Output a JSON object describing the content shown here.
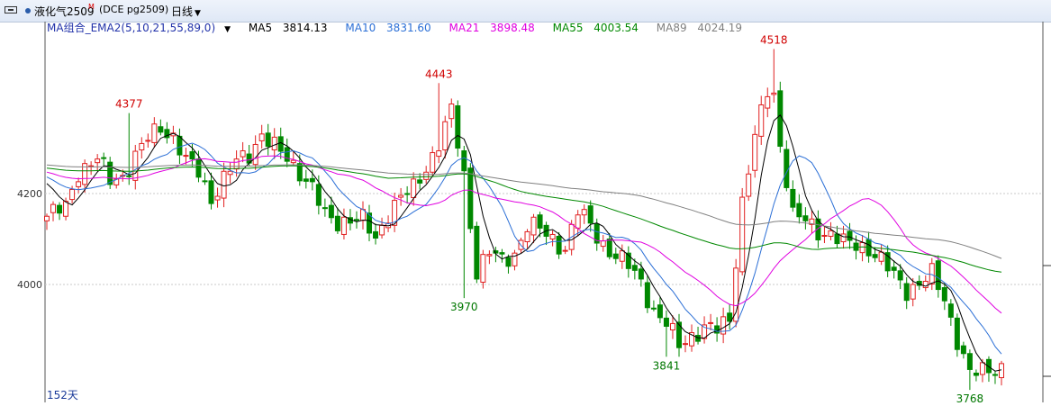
{
  "header": {
    "instrument": "液化气2509",
    "contract_mark": "M",
    "code": "(DCE pg2509)",
    "period": "日线"
  },
  "legend": {
    "group_label": "MA组合_EMA2(5,10,21,55,89,0)",
    "items": [
      {
        "label": "MA5",
        "value": "3814.13",
        "color": "#000000"
      },
      {
        "label": "MA10",
        "value": "3831.60",
        "color": "#2b6fd6"
      },
      {
        "label": "MA21",
        "value": "3898.48",
        "color": "#e000e0"
      },
      {
        "label": "MA55",
        "value": "4003.54",
        "color": "#008800"
      },
      {
        "label": "MA89",
        "value": "4024.19",
        "color": "#808080"
      }
    ]
  },
  "footer": {
    "days_label": "152天"
  },
  "colors": {
    "up": "#e02020",
    "down": "#008800",
    "grid": "#c8c8c8"
  },
  "chart_data": {
    "type": "candlestick",
    "y_ticks": [
      4000,
      4200
    ],
    "ylim": [
      3742,
      4583
    ],
    "grid_dashed": true,
    "candle_count": 152,
    "annotations": [
      {
        "label": "4377",
        "kind": "high",
        "index": 13
      },
      {
        "label": "4443",
        "kind": "high",
        "index": 62
      },
      {
        "label": "3970",
        "kind": "low",
        "index": 66
      },
      {
        "label": "3841",
        "kind": "low",
        "index": 98
      },
      {
        "label": "4518",
        "kind": "high",
        "index": 115
      },
      {
        "label": "3768",
        "kind": "low",
        "index": 146
      }
    ],
    "close_path": [
      [
        0,
        4150
      ],
      [
        3,
        4170
      ],
      [
        5,
        4250
      ],
      [
        8,
        4275
      ],
      [
        10,
        4230
      ],
      [
        12,
        4240
      ],
      [
        14,
        4280
      ],
      [
        16,
        4320
      ],
      [
        18,
        4350
      ],
      [
        20,
        4325
      ],
      [
        22,
        4270
      ],
      [
        24,
        4250
      ],
      [
        26,
        4190
      ],
      [
        28,
        4230
      ],
      [
        30,
        4270
      ],
      [
        32,
        4290
      ],
      [
        34,
        4330
      ],
      [
        36,
        4300
      ],
      [
        38,
        4280
      ],
      [
        40,
        4250
      ],
      [
        42,
        4210
      ],
      [
        44,
        4150
      ],
      [
        46,
        4140
      ],
      [
        48,
        4145
      ],
      [
        50,
        4140
      ],
      [
        52,
        4100
      ],
      [
        54,
        4160
      ],
      [
        56,
        4190
      ],
      [
        58,
        4210
      ],
      [
        60,
        4260
      ],
      [
        62,
        4310
      ],
      [
        64,
        4380
      ],
      [
        66,
        4240
      ],
      [
        68,
        4030
      ],
      [
        70,
        4070
      ],
      [
        72,
        4050
      ],
      [
        74,
        4070
      ],
      [
        76,
        4130
      ],
      [
        78,
        4120
      ],
      [
        80,
        4100
      ],
      [
        82,
        4080
      ],
      [
        84,
        4160
      ],
      [
        86,
        4130
      ],
      [
        88,
        4090
      ],
      [
        90,
        4060
      ],
      [
        92,
        4040
      ],
      [
        94,
        4010
      ],
      [
        96,
        3940
      ],
      [
        98,
        3910
      ],
      [
        100,
        3870
      ],
      [
        102,
        3890
      ],
      [
        104,
        3900
      ],
      [
        106,
        3900
      ],
      [
        108,
        3930
      ],
      [
        110,
        4180
      ],
      [
        112,
        4320
      ],
      [
        114,
        4430
      ],
      [
        115,
        4420
      ],
      [
        116,
        4310
      ],
      [
        118,
        4150
      ],
      [
        120,
        4140
      ],
      [
        122,
        4120
      ],
      [
        124,
        4110
      ],
      [
        126,
        4090
      ],
      [
        128,
        4090
      ],
      [
        130,
        4080
      ],
      [
        132,
        4050
      ],
      [
        134,
        4020
      ],
      [
        136,
        3990
      ],
      [
        138,
        4000
      ],
      [
        140,
        4020
      ],
      [
        142,
        3970
      ],
      [
        144,
        3880
      ],
      [
        146,
        3800
      ],
      [
        148,
        3810
      ],
      [
        150,
        3820
      ],
      [
        151,
        3818
      ]
    ],
    "ma_series": [
      {
        "name": "MA5",
        "window": 5
      },
      {
        "name": "MA10",
        "window": 10
      },
      {
        "name": "MA21",
        "window": 21
      },
      {
        "name": "MA55",
        "window": 55
      },
      {
        "name": "MA89",
        "window": 89
      }
    ],
    "ma_seed": [
      [
        4218,
        4225,
        4240,
        4255,
        4270,
        4265,
        4250,
        4240,
        4230,
        4235,
        4250,
        4265,
        4280,
        4290,
        4300
      ],
      [
        4240,
        4245,
        4250,
        4258,
        4265,
        4270,
        4272,
        4268,
        4262,
        4258,
        4255,
        4256,
        4260,
        4266,
        4272
      ]
    ]
  }
}
